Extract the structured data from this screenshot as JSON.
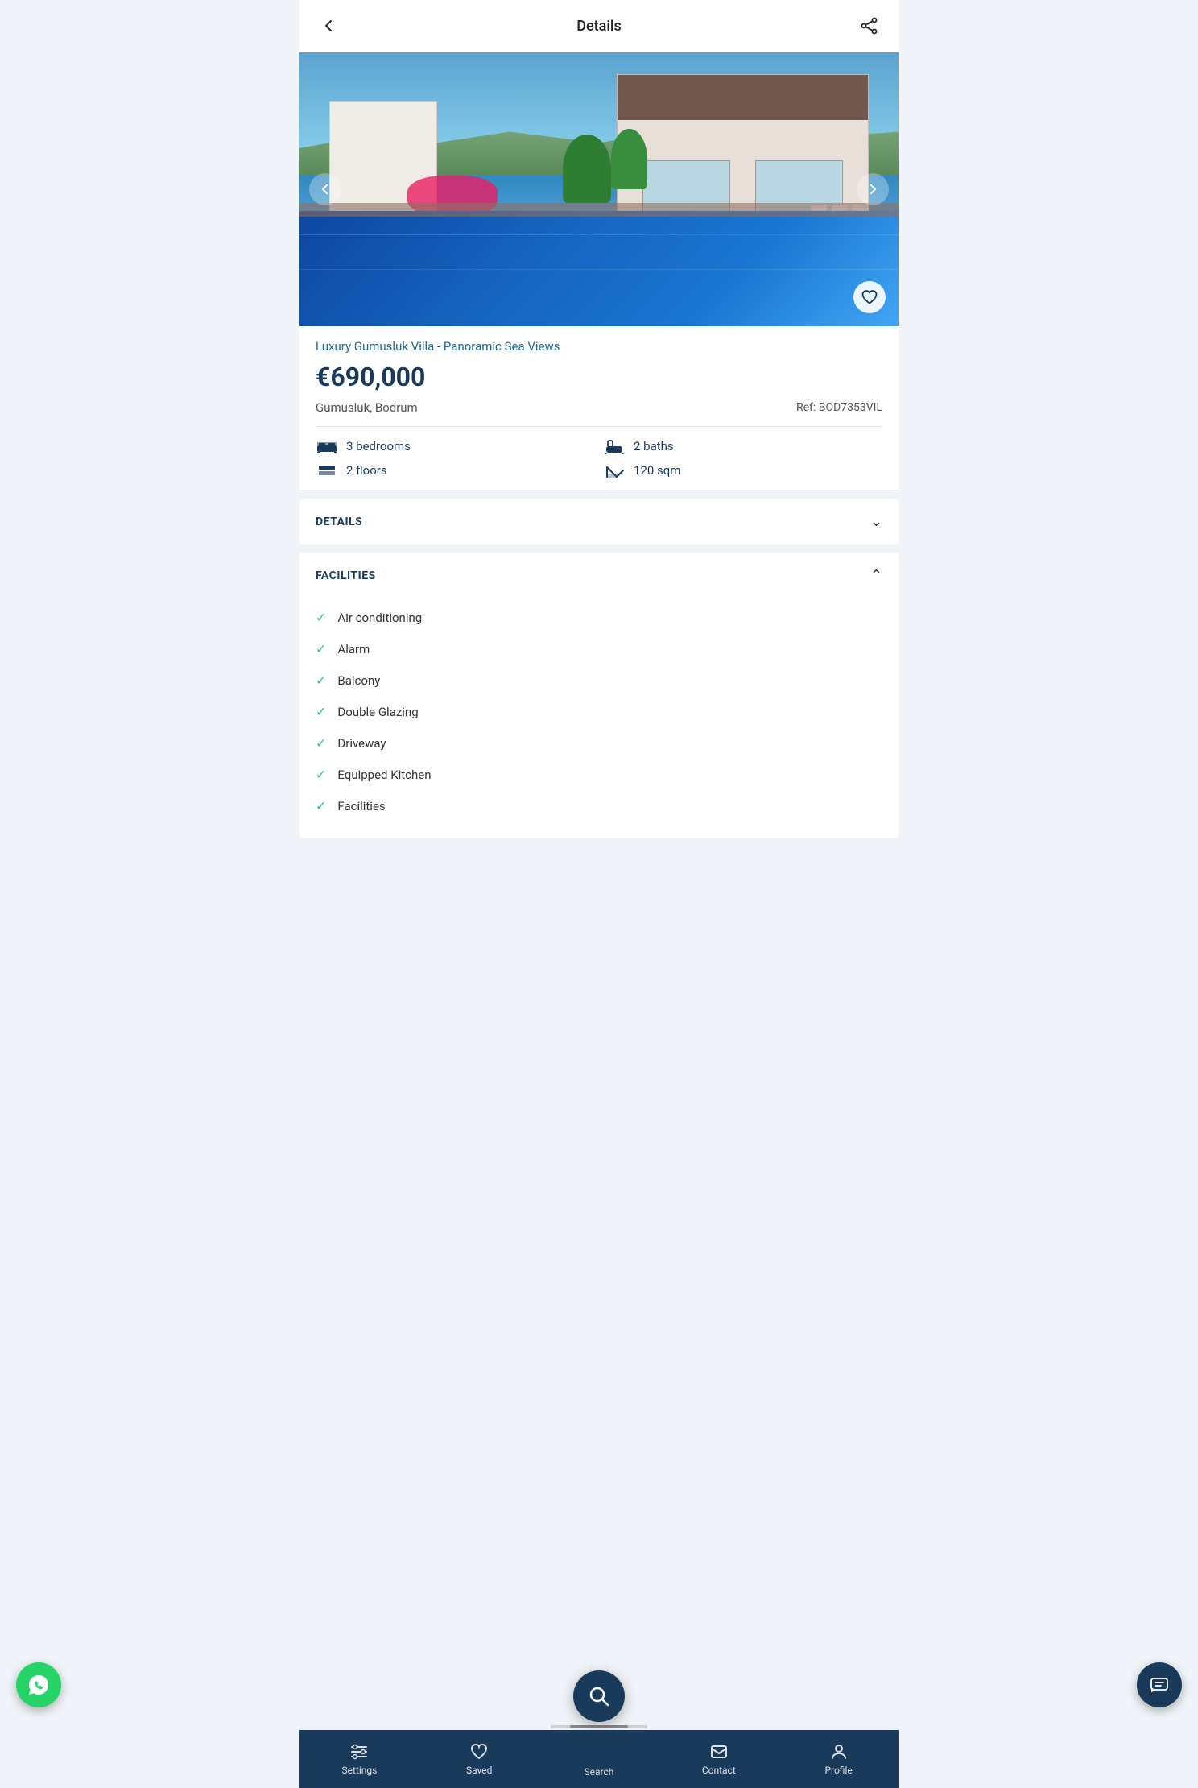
{
  "header": {
    "title": "Details",
    "back_label": "back",
    "share_label": "share"
  },
  "hero": {
    "prev_label": "previous image",
    "next_label": "next image",
    "heart_label": "save to favorites"
  },
  "property": {
    "title": "Luxury Gumusluk Villa - Panoramic Sea Views",
    "price": "€690,000",
    "location": "Gumusluk, Bodrum",
    "ref": "Ref: BOD7353VIL",
    "bedrooms": "3 bedrooms",
    "baths": "2 baths",
    "floors": "2 floors",
    "sqm": "120 sqm"
  },
  "sections": {
    "details": {
      "label": "DETAILS",
      "expanded": false
    },
    "facilities": {
      "label": "FACILITIES",
      "expanded": true,
      "items": [
        "Air conditioning",
        "Alarm",
        "Balcony",
        "Double Glazing",
        "Driveway",
        "Equipped Kitchen",
        "Facilities"
      ]
    }
  },
  "bottom_nav": {
    "items": [
      {
        "id": "settings",
        "label": "Settings"
      },
      {
        "id": "saved",
        "label": "Saved"
      },
      {
        "id": "search",
        "label": "Search"
      },
      {
        "id": "contact",
        "label": "Contact"
      },
      {
        "id": "profile",
        "label": "Profile"
      }
    ]
  },
  "colors": {
    "primary": "#1a3a5c",
    "accent": "#1a6a9a",
    "check": "#2ecc71",
    "whatsapp": "#25D366",
    "white": "#ffffff"
  }
}
